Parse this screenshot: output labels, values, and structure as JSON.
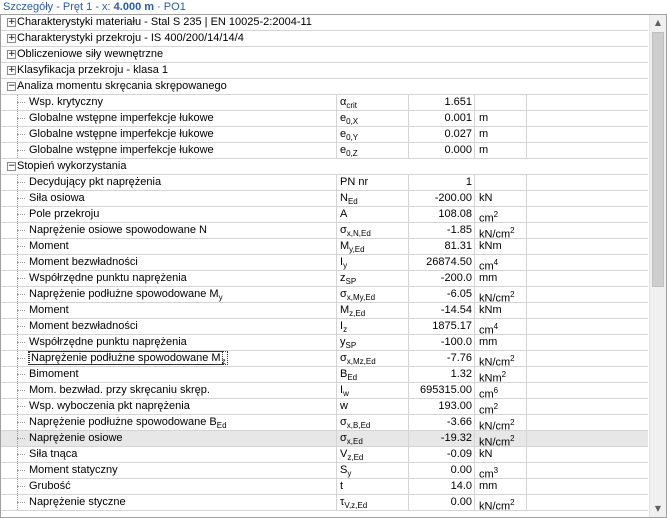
{
  "title": {
    "prefix": "Szczegóły - Pręt 1 - x: ",
    "position": "4.000 m",
    "suffix": " · PO1"
  },
  "sections": [
    {
      "expander": "+",
      "label": "Charakterystyki materiału -  Stal S 235 | EN 10025-2:2004-11"
    },
    {
      "expander": "+",
      "label": "Charakterystyki przekroju  -  IS 400/200/14/14/4"
    },
    {
      "expander": "+",
      "label": "Obliczeniowe siły wewnętrzne"
    },
    {
      "expander": "+",
      "label": "Klasyfikacja przekroju - klasa 1"
    },
    {
      "expander": "−",
      "label": "Analiza momentu skręcania skrępowanego"
    },
    {
      "expander": "−",
      "label": "Stopień wykorzystania"
    }
  ],
  "torsion_rows": [
    {
      "label": "Wsp. krytyczny",
      "sym": "α",
      "sub": "crit",
      "value": "1.651",
      "unit": "",
      "sup": ""
    },
    {
      "label": "Globalne wstępne imperfekcje łukowe",
      "sym": "e",
      "sub": "0,X",
      "value": "0.001",
      "unit": "m",
      "sup": ""
    },
    {
      "label": "Globalne wstępne imperfekcje łukowe",
      "sym": "e",
      "sub": "0,Y",
      "value": "0.027",
      "unit": "m",
      "sup": ""
    },
    {
      "label": "Globalne wstępne imperfekcje łukowe",
      "sym": "e",
      "sub": "0,Z",
      "value": "0.000",
      "unit": "m",
      "sup": ""
    }
  ],
  "util_rows": [
    {
      "label": "Decydujący pkt naprężenia",
      "sym": "PN nr",
      "sub": "",
      "value": "1",
      "unit": "",
      "sup": ""
    },
    {
      "label": "Siła osiowa",
      "sym": "N",
      "sub": "Ed",
      "value": "-200.00",
      "unit": "kN",
      "sup": ""
    },
    {
      "label": "Pole przekroju",
      "sym": "A",
      "sub": "",
      "value": "108.08",
      "unit": "cm",
      "sup": "2"
    },
    {
      "label": "Naprężenie osiowe spowodowane N",
      "sym": "σ",
      "sub": "x,N,Ed",
      "value": "-1.85",
      "unit": "kN/cm",
      "sup": "2"
    },
    {
      "label": "Moment",
      "sym": "M",
      "sub": "y,Ed",
      "value": "81.31",
      "unit": "kNm",
      "sup": ""
    },
    {
      "label": "Moment bezwładności",
      "sym": "I",
      "sub": "y",
      "value": "26874.50",
      "unit": "cm",
      "sup": "4"
    },
    {
      "label": "Współrzędne punktu naprężenia",
      "sym": "z",
      "sub": "SP",
      "value": "-200.0",
      "unit": "mm",
      "sup": ""
    },
    {
      "label": "Naprężenie podłużne spowodowane M",
      "label_sub": "y",
      "sym": "σ",
      "sub": "x,My,Ed",
      "value": "-6.05",
      "unit": "kN/cm",
      "sup": "2"
    },
    {
      "label": "Moment",
      "sym": "M",
      "sub": "z,Ed",
      "value": "-14.54",
      "unit": "kNm",
      "sup": ""
    },
    {
      "label": "Moment bezwładności",
      "sym": "I",
      "sub": "z",
      "value": "1875.17",
      "unit": "cm",
      "sup": "4"
    },
    {
      "label": "Współrzędne punktu naprężenia",
      "sym": "y",
      "sub": "SP",
      "value": "-100.0",
      "unit": "mm",
      "sup": ""
    },
    {
      "label": "Naprężenie podłużne spowodowane M",
      "label_sub": "z",
      "sym": "σ",
      "sub": "x,Mz,Ed",
      "value": "-7.76",
      "unit": "kN/cm",
      "sup": "2",
      "focus": true
    },
    {
      "label": "Bimoment",
      "sym": "B",
      "sub": "Ed",
      "value": "1.32",
      "unit": "kNm",
      "sup": "2"
    },
    {
      "label": "Mom. bezwład. przy skręcaniu skręp.",
      "sym": "I",
      "sub": "w",
      "value": "695315.00",
      "unit": "cm",
      "sup": "6"
    },
    {
      "label": "Wsp. wyboczenia pkt naprężenia",
      "sym": "w",
      "sub": "",
      "value": "193.00",
      "unit": "cm",
      "sup": "2"
    },
    {
      "label": "Naprężenie podłużne spowodowane B",
      "label_sub": "Ed",
      "sym": "σ",
      "sub": "x,B,Ed",
      "value": "-3.66",
      "unit": "kN/cm",
      "sup": "2"
    },
    {
      "label": "Naprężenie osiowe",
      "sym": "σ",
      "sub": "x,Ed",
      "value": "-19.32",
      "unit": "kN/cm",
      "sup": "2",
      "highlight": true
    },
    {
      "label": "Siła tnąca",
      "sym": "V",
      "sub": "z,Ed",
      "value": "-0.09",
      "unit": "kN",
      "sup": ""
    },
    {
      "label": "Moment statyczny",
      "sym": "S",
      "sub": "y",
      "value": "0.00",
      "unit": "cm",
      "sup": "3"
    },
    {
      "label": "Grubość",
      "sym": "t",
      "sub": "",
      "value": "14.0",
      "unit": "mm",
      "sup": ""
    },
    {
      "label": "Naprężenie styczne",
      "sym": "τ",
      "sub": "V,z,Ed",
      "value": "0.00",
      "unit": "kN/cm",
      "sup": "2"
    }
  ],
  "scrollbar": {
    "up_icon": "▲",
    "down_icon": "▼"
  },
  "colors": {
    "title": "#2a5ba8",
    "highlight_row": "#e7e7e7",
    "grid": "#d4d4d4"
  }
}
